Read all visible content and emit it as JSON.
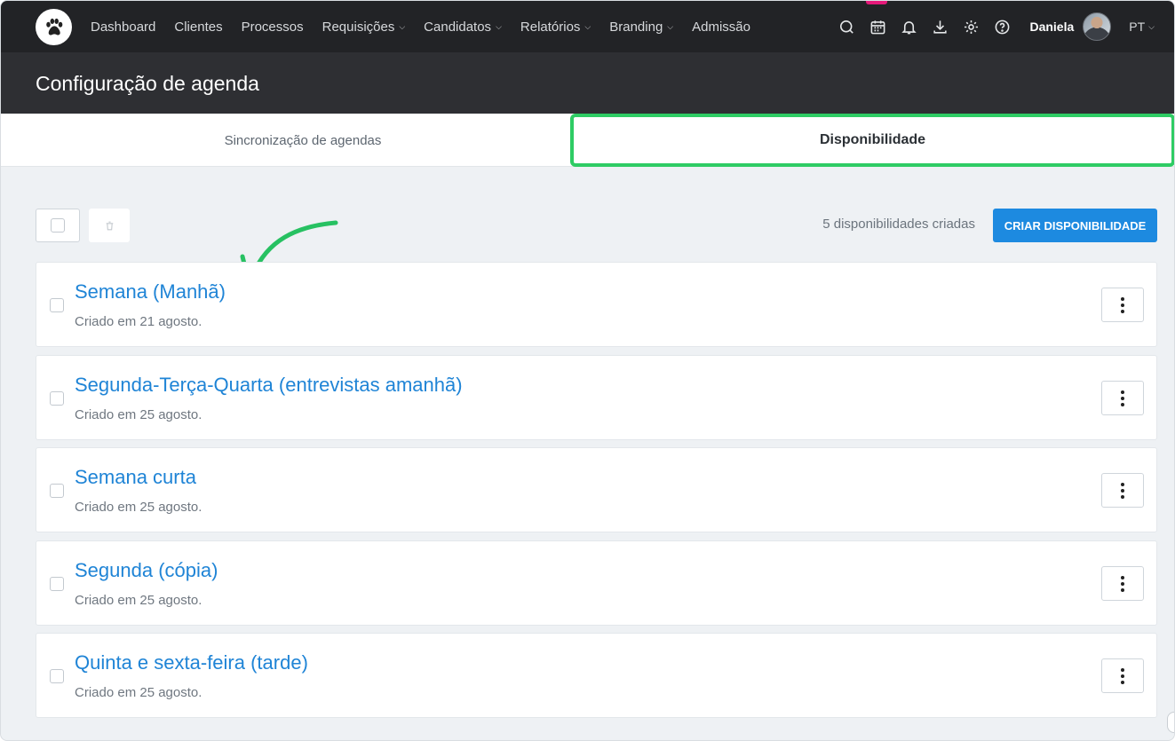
{
  "nav": {
    "items": [
      {
        "label": "Dashboard",
        "dropdown": false
      },
      {
        "label": "Clientes",
        "dropdown": false
      },
      {
        "label": "Processos",
        "dropdown": false
      },
      {
        "label": "Requisições",
        "dropdown": true
      },
      {
        "label": "Candidatos",
        "dropdown": true
      },
      {
        "label": "Relatórios",
        "dropdown": true
      },
      {
        "label": "Branding",
        "dropdown": true
      },
      {
        "label": "Admissão",
        "dropdown": false
      }
    ],
    "icons": [
      "chat-icon",
      "calendar-icon",
      "bell-icon",
      "download-icon",
      "gear-icon",
      "help-icon"
    ],
    "user_name": "Daniela",
    "language": "PT"
  },
  "page": {
    "title": "Configuração de agenda"
  },
  "tabs": {
    "sync": "Sincronização de agendas",
    "availability": "Disponibilidade"
  },
  "toolbar": {
    "count_text": "5 disponibilidades criadas",
    "create_label": "CRIAR DISPONIBILIDADE"
  },
  "availabilities": [
    {
      "title": "Semana (Manhã)",
      "created": "Criado em 21 agosto."
    },
    {
      "title": "Segunda-Terça-Quarta (entrevistas amanhã)",
      "created": "Criado em 25 agosto."
    },
    {
      "title": "Semana curta",
      "created": "Criado em 25 agosto."
    },
    {
      "title": "Segunda (cópia)",
      "created": "Criado em 25 agosto."
    },
    {
      "title": "Quinta e sexta-feira (tarde)",
      "created": "Criado em 25 agosto."
    }
  ],
  "colors": {
    "accent": "#1d8ae0",
    "highlight": "#2ecc64",
    "active_marker": "#e6197a",
    "nav_bg": "#222326"
  }
}
